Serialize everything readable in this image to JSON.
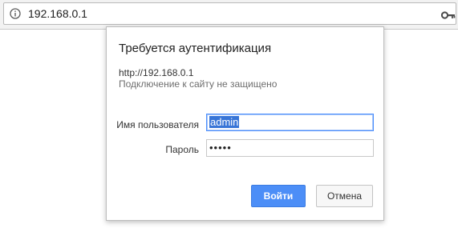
{
  "browser": {
    "address": "192.168.0.1",
    "info_icon": "info-icon",
    "key_icon": "key-icon"
  },
  "dialog": {
    "title": "Требуется аутентификация",
    "url": "http://192.168.0.1",
    "warning": "Подключение к сайту не защищено",
    "username_label": "Имя пользователя",
    "username_value": "admin",
    "password_label": "Пароль",
    "password_masked": "•••••",
    "login_button": "Войти",
    "cancel_button": "Отмена"
  },
  "colors": {
    "accent": "#4c8ef7",
    "selection": "#3875d7"
  }
}
